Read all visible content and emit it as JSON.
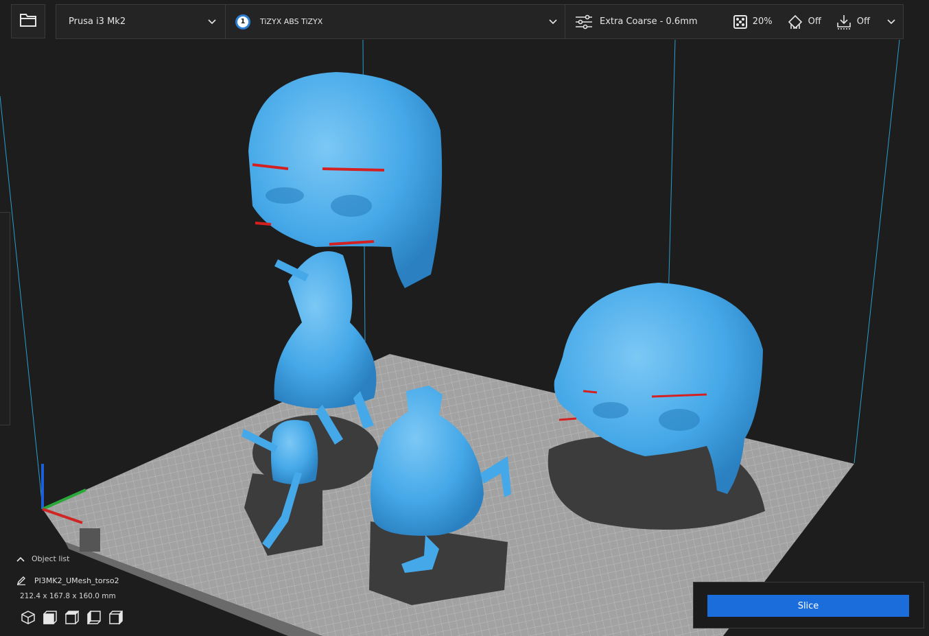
{
  "toolbar": {
    "open_file_icon": "folder-icon",
    "printer": {
      "name": "Prusa i3 Mk2"
    },
    "material": {
      "extruder_number": "1",
      "name": "TiZYX ABS TiZYX"
    },
    "profile": {
      "name": "Extra Coarse - 0.6mm",
      "infill": "20%",
      "support": "Off",
      "adhesion": "Off"
    }
  },
  "object_panel": {
    "header": "Object list",
    "object_name": "PI3MK2_UMesh_torso2",
    "dimensions": "212.4 x 167.8 x 160.0 mm",
    "view_buttons": [
      "3d-view-icon",
      "front-view-icon",
      "top-view-icon",
      "left-view-icon",
      "right-view-icon"
    ]
  },
  "slice_panel": {
    "button_label": "Slice"
  },
  "colors": {
    "model": "#45a8e8",
    "model_overhang": "#d42020",
    "build_plate": "#9c9c9c",
    "accent": "#1c6ddc",
    "background": "#1d1d1d"
  }
}
